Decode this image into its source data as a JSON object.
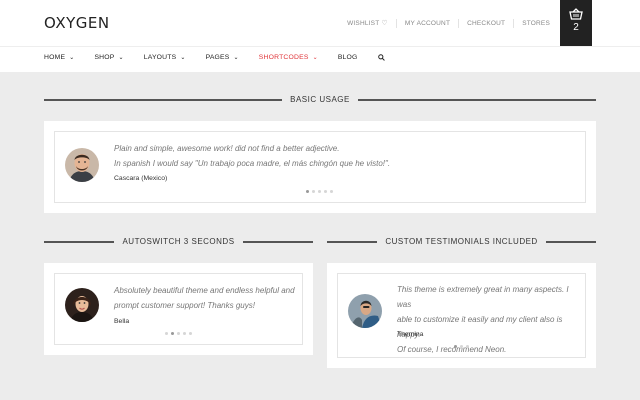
{
  "header": {
    "logo": "OXYGEN",
    "top_links": [
      "WISHLIST",
      "MY ACCOUNT",
      "CHECKOUT",
      "STORES"
    ],
    "cart_count": "2"
  },
  "nav": {
    "items": [
      {
        "label": "HOME",
        "dropdown": true
      },
      {
        "label": "SHOP",
        "dropdown": true
      },
      {
        "label": "LAYOUTS",
        "dropdown": true
      },
      {
        "label": "PAGES",
        "dropdown": true
      },
      {
        "label": "SHORTCODES",
        "dropdown": true,
        "active": true
      },
      {
        "label": "BLOG",
        "dropdown": false
      }
    ],
    "accent_color": "#e0353a"
  },
  "sections": {
    "basic": {
      "heading": "BASIC USAGE",
      "quote_line1": "Plain and simple, awesome work! did not find a better adjective.",
      "quote_line2": "In spanish I would say \"Un trabajo poca madre, el más chingón que he visto!\".",
      "author": "Cascara (Mexico)",
      "dots_total": 5,
      "dots_active": 1
    },
    "autoswitch": {
      "heading": "AUTOSWITCH 3 SECONDS",
      "quote_line1": "Absolutely beautiful theme and endless helpful and",
      "quote_line2": "prompt customer support! Thanks guys!",
      "author": "Bella",
      "dots_total": 5,
      "dots_active": 2
    },
    "custom": {
      "heading": "CUSTOM TESTIMONIALS INCLUDED",
      "quote_line1": "This theme is extremely great in many aspects. I was",
      "quote_line2": "able to customize it easily and my client also is happy.",
      "quote_line3": "Of course, I recommend Neon.",
      "author": "Themina",
      "dots_total": 3,
      "dots_active": 1
    }
  }
}
